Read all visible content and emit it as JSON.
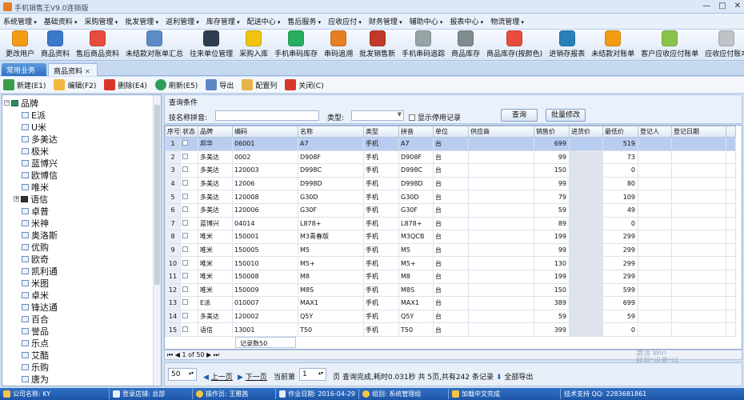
{
  "window": {
    "title": "手机销售王V9.0连锁版",
    "controls": [
      "—",
      "□",
      "✕"
    ]
  },
  "menu": [
    "系统管理",
    "基础资料",
    "采购管理",
    "批发管理",
    "返利管理",
    "库存管理",
    "配送中心",
    "售后服务",
    "应收应付",
    "财务管理",
    "辅助中心",
    "报表中心",
    "物流管理"
  ],
  "toolbar": [
    {
      "label": "更改用户",
      "color": "#f39c12"
    },
    {
      "label": "商品资料",
      "color": "#3a78c9"
    },
    {
      "label": "售后商品资料",
      "color": "#e74c3c"
    },
    {
      "label": "未结款对账单汇总",
      "color": "#5b8cc7"
    },
    {
      "label": "往来单位管理",
      "color": "#2c3e50"
    },
    {
      "label": "采购入库",
      "color": "#f1c40f"
    },
    {
      "label": "手机串码库存",
      "color": "#27ae60"
    },
    {
      "label": "串码追溯",
      "color": "#e67e22"
    },
    {
      "label": "批发销售新",
      "color": "#c0392b"
    },
    {
      "label": "手机串码追踪",
      "color": "#95a5a6"
    },
    {
      "label": "商品库存",
      "color": "#7f8c8d"
    },
    {
      "label": "商品库存(按颜色)",
      "color": "#e74c3c"
    },
    {
      "label": "进销存报表",
      "color": "#2980b9"
    },
    {
      "label": "未结款对账单",
      "color": "#f39c12"
    },
    {
      "label": "客户应收应付账单",
      "color": "#8bc34a"
    },
    {
      "label": "应收应付账本",
      "color": "#bdc3c7"
    }
  ],
  "tabs": {
    "t1": "常用业务",
    "t2": "商品资料",
    "close": "✕"
  },
  "actions": {
    "new": "新建(E1)",
    "edit": "编辑(F2)",
    "delete": "删除(E4)",
    "refresh": "刷新(E5)",
    "export": "导出",
    "config": "配置列",
    "close": "关闭(C)"
  },
  "tree": {
    "root": "品牌",
    "items": [
      "E派",
      "U米",
      "多美达",
      "极米",
      "蓝博兴",
      "欧博信",
      "唯米",
      "语信",
      "卓普",
      "米神",
      "奥洛斯",
      "优购",
      "欧奇",
      "凯利通",
      "米图",
      "卓米",
      "锋达通",
      "百合",
      "誉品",
      "乐点",
      "艾酷",
      "乐购",
      "唐为"
    ]
  },
  "query": {
    "header": "查询条件",
    "name_label": "技名称拼音:",
    "name_value": "",
    "type_label": "类型:",
    "type_value": "",
    "stop_label": "显示停用记录",
    "query_btn": "查询",
    "batch_btn": "批量修改"
  },
  "grid": {
    "headers": [
      "序号",
      "状态",
      "品牌",
      "编码",
      "名称",
      "类型",
      "拼音",
      "单位",
      "供应商",
      "销售价",
      "进货价",
      "最低价",
      "登记人",
      "登记日期"
    ],
    "rows": [
      [
        "1",
        "",
        "邦华",
        "06001",
        "A7",
        "手机",
        "A7",
        "台",
        "",
        "699",
        "",
        "519",
        "",
        ""
      ],
      [
        "2",
        "",
        "多美达",
        "0002",
        "D908F",
        "手机",
        "D908F",
        "台",
        "",
        "99",
        "",
        "73",
        "",
        ""
      ],
      [
        "3",
        "",
        "多美达",
        "120003",
        "D998C",
        "手机",
        "D998C",
        "台",
        "",
        "150",
        "",
        "0",
        "",
        ""
      ],
      [
        "4",
        "",
        "多美达",
        "12006",
        "D998D",
        "手机",
        "D998D",
        "台",
        "",
        "99",
        "",
        "80",
        "",
        ""
      ],
      [
        "5",
        "",
        "多美达",
        "120008",
        "G30D",
        "手机",
        "G30D",
        "台",
        "",
        "79",
        "",
        "109",
        "",
        ""
      ],
      [
        "6",
        "",
        "多美达",
        "120006",
        "G30F",
        "手机",
        "G30F",
        "台",
        "",
        "59",
        "",
        "49",
        "",
        ""
      ],
      [
        "7",
        "",
        "蓝博兴",
        "04014",
        "L878+",
        "手机",
        "L878+",
        "台",
        "",
        "89",
        "",
        "0",
        "",
        ""
      ],
      [
        "8",
        "",
        "唯米",
        "150001",
        "M3青春版",
        "手机",
        "M3QCB",
        "台",
        "",
        "199",
        "",
        "299",
        "",
        ""
      ],
      [
        "9",
        "",
        "唯米",
        "150005",
        "M5",
        "手机",
        "M5",
        "台",
        "",
        "99",
        "",
        "299",
        "",
        ""
      ],
      [
        "10",
        "",
        "唯米",
        "150010",
        "M5+",
        "手机",
        "M5+",
        "台",
        "",
        "130",
        "",
        "299",
        "",
        ""
      ],
      [
        "11",
        "",
        "唯米",
        "150008",
        "M8",
        "手机",
        "M8",
        "台",
        "",
        "199",
        "",
        "299",
        "",
        ""
      ],
      [
        "12",
        "",
        "唯米",
        "150009",
        "M8S",
        "手机",
        "M8S",
        "台",
        "",
        "150",
        "",
        "599",
        "",
        ""
      ],
      [
        "13",
        "",
        "E派",
        "010007",
        "MAX1",
        "手机",
        "MAX1",
        "台",
        "",
        "389",
        "",
        "699",
        "",
        ""
      ],
      [
        "14",
        "",
        "多美达",
        "120002",
        "Q5Y",
        "手机",
        "Q5Y",
        "台",
        "",
        "59",
        "",
        "59",
        "",
        ""
      ],
      [
        "15",
        "",
        "语信",
        "13001",
        "T50",
        "手机",
        "T50",
        "台",
        "",
        "399",
        "",
        "0",
        "",
        ""
      ]
    ]
  },
  "pager": {
    "nav": "1 of 50",
    "count": "记录数50",
    "pagesize": "50",
    "prev": "上一页",
    "next": "下一页",
    "current_label": "当前第",
    "page": "1",
    "page_unit": "页",
    "info": "查询完成,耗时0.031秒 共 5页,共有242 条记录",
    "export_all": "全部导出"
  },
  "watermark": {
    "line1": "激活 Win",
    "line2": "转到\"设置\"以"
  },
  "status": {
    "company": "公司名称: KY",
    "store": "登录店铺: 总部",
    "operator": "操作员: 王雅茜",
    "date": "作业日期: 2016-04-29",
    "group": "组别: 系统管理组",
    "lang": "加载中文完成",
    "support": "技术支持 QQ: 2283681861"
  }
}
